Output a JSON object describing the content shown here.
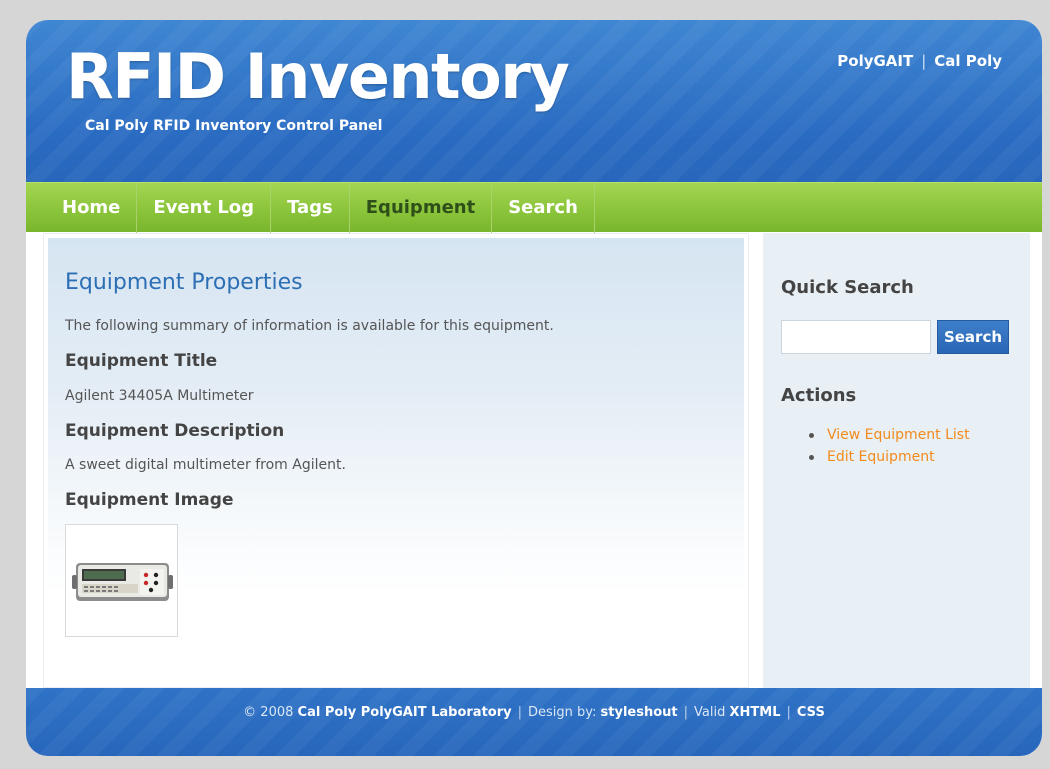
{
  "header": {
    "logo": "RFID Inventory",
    "slogan": "Cal Poly RFID Inventory Control Panel",
    "links": [
      "PolyGAIT",
      "Cal Poly"
    ]
  },
  "menu": {
    "items": [
      "Home",
      "Event Log",
      "Tags",
      "Equipment",
      "Search"
    ],
    "current": "Equipment"
  },
  "main": {
    "title": "Equipment Properties",
    "intro": "The following summary of information is available for this equipment.",
    "title_heading": "Equipment Title",
    "title_value": "Agilent 34405A Multimeter",
    "description_heading": "Equipment Description",
    "description_value": "A sweet digital multimeter from Agilent.",
    "image_heading": "Equipment Image"
  },
  "sidebar": {
    "quick_search_heading": "Quick Search",
    "search_button": "Search",
    "search_value": "",
    "actions_heading": "Actions",
    "actions": [
      "View Equipment List",
      "Edit Equipment"
    ]
  },
  "footer": {
    "copyright": "© 2008",
    "lab": "Cal Poly PolyGAIT Laboratory",
    "design_by": "Design by:",
    "designer": "styleshout",
    "valid": "Valid",
    "xhtml": "XHTML",
    "css": "CSS"
  },
  "colors": {
    "header_blue": "#2a6cc2",
    "menu_green": "#8bc53b",
    "link_orange": "#f28a1c",
    "title_blue": "#2d6fb5"
  }
}
